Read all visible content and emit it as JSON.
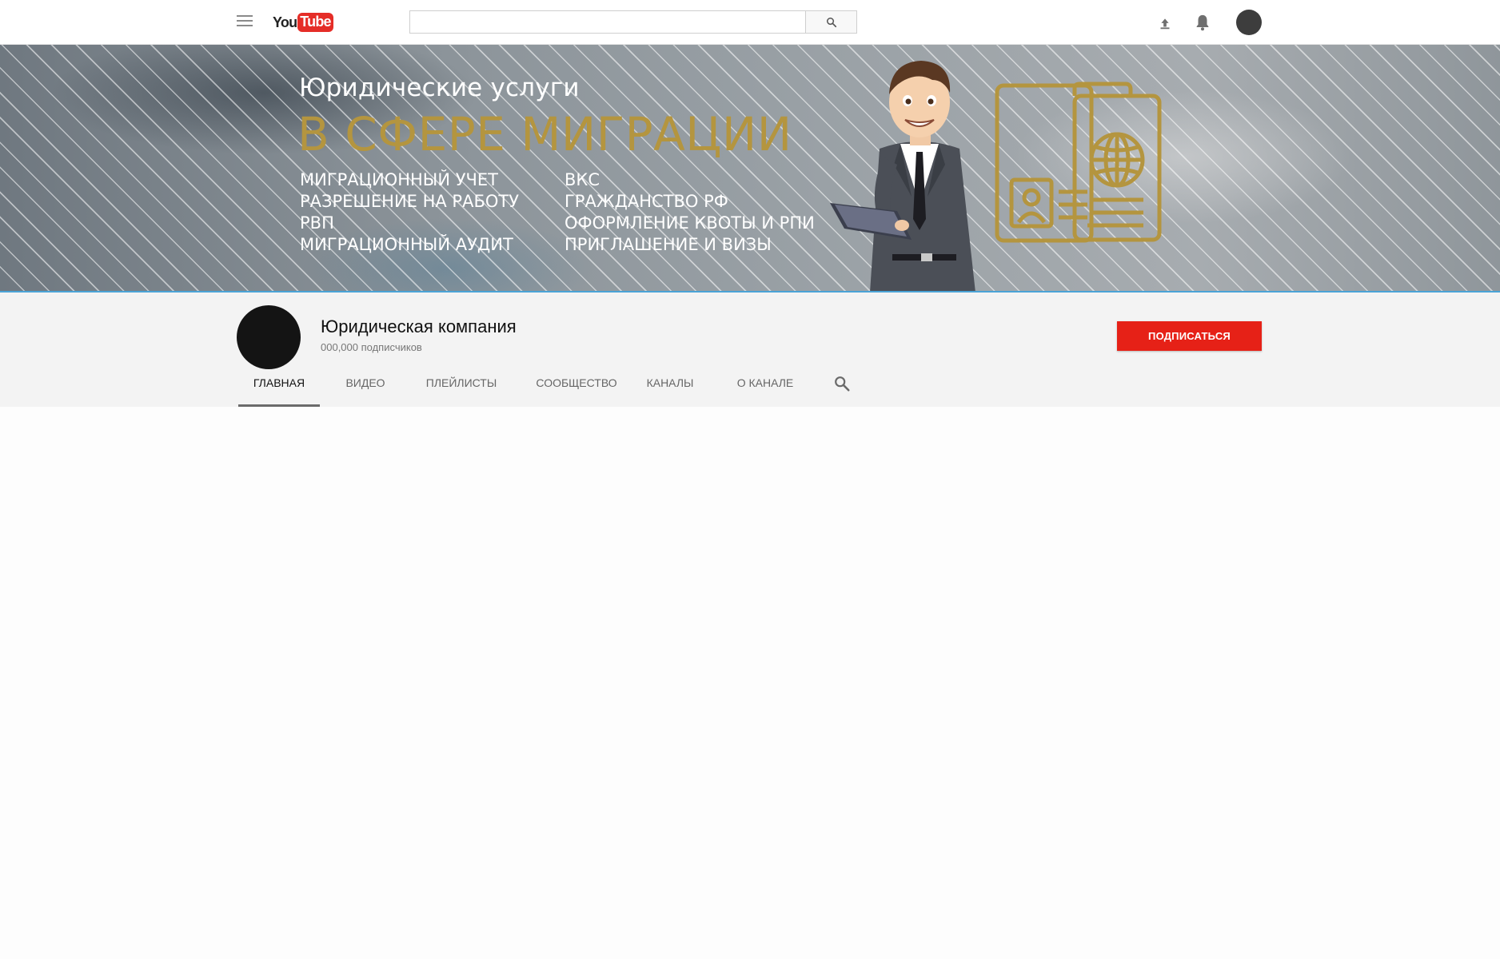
{
  "topbar": {
    "logo_you": "You",
    "logo_tube": "Tube",
    "search_placeholder": "",
    "icons": [
      "menu-icon",
      "search-icon",
      "upload-icon",
      "bell-icon",
      "avatar"
    ]
  },
  "banner": {
    "subtitle": "Юридические услуги",
    "title": "В СФЕРЕ МИГРАЦИИ",
    "services_left": [
      "МИГРАЦИОННЫЙ УЧЕТ",
      "РАЗРЕШЕНИЕ НА РАБОТУ",
      "РВП",
      "МИГРАЦИОННЫЙ АУДИТ"
    ],
    "services_right": [
      "ВКС",
      "ГРАЖДАНСТВО РФ",
      "ОФОРМЛЕНИЕ КВОТЫ И РПИ",
      "ПРИГЛАШЕНИЕ И ВИЗЫ"
    ],
    "colors": {
      "gold": "#b4953f",
      "text": "#ffffff",
      "stripe": "#ffffff"
    },
    "icons": [
      "businessman-illustration",
      "passport-globe-icon"
    ]
  },
  "channel": {
    "name": "Юридическая компания",
    "subscribers": "000,000 подписчиков",
    "subscribe_label": "ПОДПИСАТЬСЯ",
    "subscribe_color": "#e62117"
  },
  "tabs": [
    {
      "label": "ГЛАВНАЯ",
      "active": true
    },
    {
      "label": "ВИДЕО",
      "active": false
    },
    {
      "label": "ПЛЕЙЛИСТЫ",
      "active": false
    },
    {
      "label": "СООБЩЕСТВО",
      "active": false
    },
    {
      "label": "КАНАЛЫ",
      "active": false
    },
    {
      "label": "О КАНАЛЕ",
      "active": false
    }
  ]
}
